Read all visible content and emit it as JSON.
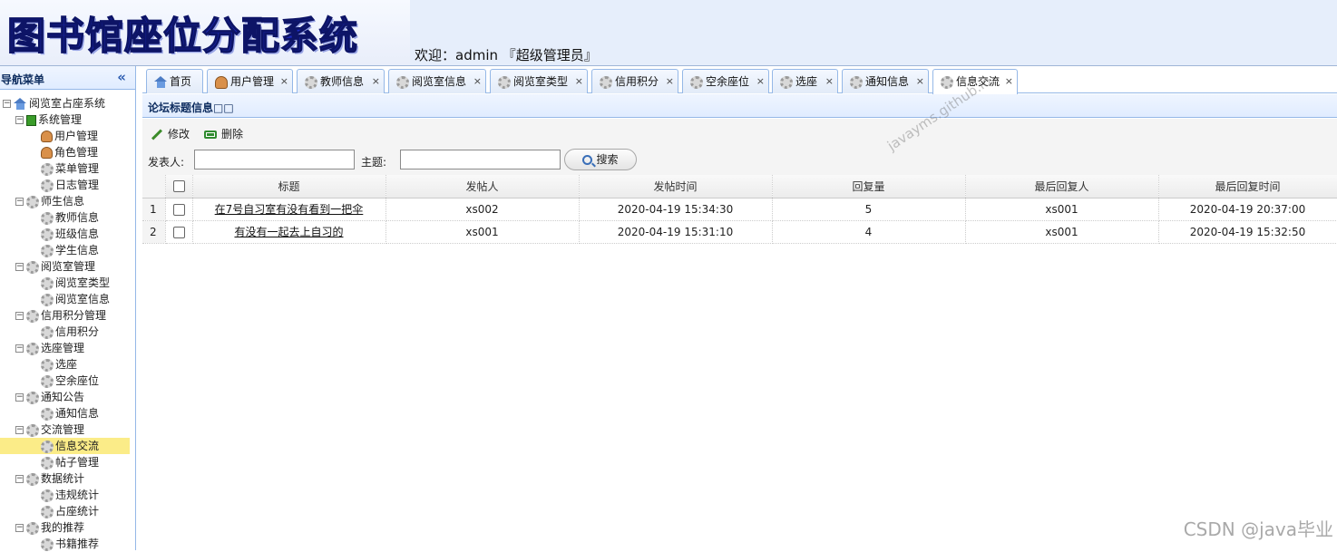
{
  "header": {
    "logo_text": "图书馆座位分配系统",
    "welcome": "欢迎：admin 『超级管理员』"
  },
  "sidebar": {
    "title": "导航菜单",
    "collapse_icon": "«",
    "tree": [
      {
        "label": "阅览室占座系统",
        "level": 0,
        "icon": "home-icon"
      },
      {
        "label": "系统管理",
        "level": 1,
        "icon": "green-square-icon"
      },
      {
        "label": "用户管理",
        "level": 2,
        "icon": "user-icon"
      },
      {
        "label": "角色管理",
        "level": 2,
        "icon": "users-icon"
      },
      {
        "label": "菜单管理",
        "level": 2,
        "icon": "gear-icon"
      },
      {
        "label": "日志管理",
        "level": 2,
        "icon": "gear-icon"
      },
      {
        "label": "师生信息",
        "level": 1,
        "icon": "gear-icon"
      },
      {
        "label": "教师信息",
        "level": 2,
        "icon": "gear-icon"
      },
      {
        "label": "班级信息",
        "level": 2,
        "icon": "gear-icon"
      },
      {
        "label": "学生信息",
        "level": 2,
        "icon": "gear-icon"
      },
      {
        "label": "阅览室管理",
        "level": 1,
        "icon": "gear-icon"
      },
      {
        "label": "阅览室类型",
        "level": 2,
        "icon": "gear-icon"
      },
      {
        "label": "阅览室信息",
        "level": 2,
        "icon": "gear-icon"
      },
      {
        "label": "信用积分管理",
        "level": 1,
        "icon": "gear-icon"
      },
      {
        "label": "信用积分",
        "level": 2,
        "icon": "gear-icon"
      },
      {
        "label": "选座管理",
        "level": 1,
        "icon": "gear-icon"
      },
      {
        "label": "选座",
        "level": 2,
        "icon": "gear-icon"
      },
      {
        "label": "空余座位",
        "level": 2,
        "icon": "gear-icon"
      },
      {
        "label": "通知公告",
        "level": 1,
        "icon": "gear-icon"
      },
      {
        "label": "通知信息",
        "level": 2,
        "icon": "gear-icon"
      },
      {
        "label": "交流管理",
        "level": 1,
        "icon": "gear-icon"
      },
      {
        "label": "信息交流",
        "level": 2,
        "icon": "gear-icon",
        "selected": true
      },
      {
        "label": "帖子管理",
        "level": 2,
        "icon": "gear-icon"
      },
      {
        "label": "数据统计",
        "level": 1,
        "icon": "gear-icon"
      },
      {
        "label": "违规统计",
        "level": 2,
        "icon": "gear-icon"
      },
      {
        "label": "占座统计",
        "level": 2,
        "icon": "gear-icon"
      },
      {
        "label": "我的推荐",
        "level": 1,
        "icon": "gear-icon"
      },
      {
        "label": "书籍推荐",
        "level": 2,
        "icon": "gear-icon"
      }
    ]
  },
  "tabs": [
    {
      "label": "首页",
      "icon": "home-icon",
      "closable": false
    },
    {
      "label": "用户管理",
      "icon": "user-icon",
      "closable": true
    },
    {
      "label": "教师信息",
      "icon": "gear-icon",
      "closable": true
    },
    {
      "label": "阅览室信息",
      "icon": "gear-icon",
      "closable": true
    },
    {
      "label": "阅览室类型",
      "icon": "gear-icon",
      "closable": true
    },
    {
      "label": "信用积分",
      "icon": "gear-icon",
      "closable": true
    },
    {
      "label": "空余座位",
      "icon": "gear-icon",
      "closable": true
    },
    {
      "label": "选座",
      "icon": "gear-icon",
      "closable": true
    },
    {
      "label": "通知信息",
      "icon": "gear-icon",
      "closable": true
    },
    {
      "label": "信息交流",
      "icon": "gear-icon",
      "closable": true,
      "active": true
    }
  ],
  "panel": {
    "title": "论坛标题信息□□"
  },
  "toolbar": {
    "edit_label": "修改",
    "delete_label": "删除",
    "poster_label": "发表人:",
    "poster_value": "",
    "topic_label": "主题:",
    "topic_value": "",
    "search_label": "搜索"
  },
  "grid": {
    "columns": [
      "标题",
      "发帖人",
      "发帖时间",
      "回复量",
      "最后回复人",
      "最后回复时间"
    ],
    "rows": [
      {
        "num": "1",
        "title": "在7号自习室有没有看到一把伞",
        "poster": "xs002",
        "post_time": "2020-04-19 15:34:30",
        "replies": "5",
        "last_replier": "xs001",
        "last_reply_time": "2020-04-19 20:37:00"
      },
      {
        "num": "2",
        "title": "有没有一起去上自习的",
        "poster": "xs001",
        "post_time": "2020-04-19 15:31:10",
        "replies": "4",
        "last_replier": "xs001",
        "last_reply_time": "2020-04-19 15:32:50"
      }
    ]
  },
  "watermarks": {
    "diagonal": "javayms.github.io",
    "corner": "CSDN @java毕业"
  }
}
